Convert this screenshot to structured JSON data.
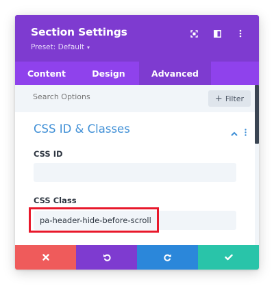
{
  "header": {
    "title": "Section Settings",
    "preset": "Preset: Default",
    "color": "#7e3bd0"
  },
  "tabs": [
    {
      "label": "Content",
      "active": false
    },
    {
      "label": "Design",
      "active": false
    },
    {
      "label": "Advanced",
      "active": true
    }
  ],
  "search": {
    "placeholder": "Search Options",
    "filter_label": "Filter"
  },
  "section": {
    "title": "CSS ID & Classes",
    "css_id_label": "CSS ID",
    "css_id_value": "",
    "css_class_label": "CSS Class",
    "css_class_value": "pa-header-hide-before-scroll"
  },
  "footer": {
    "discard_color": "#ef5b5b",
    "undo_color": "#7e3bd0",
    "redo_color": "#2b87da",
    "save_color": "#29c4a9"
  },
  "accent": "#3f8fd6",
  "highlight_color": "#e8182b",
  "icons": [
    "fullscreen-icon",
    "split-view-icon",
    "more-vert-icon",
    "chevron-up-icon",
    "close-icon",
    "undo-icon",
    "redo-icon",
    "check-icon",
    "plus-icon",
    "caret-down-icon"
  ]
}
